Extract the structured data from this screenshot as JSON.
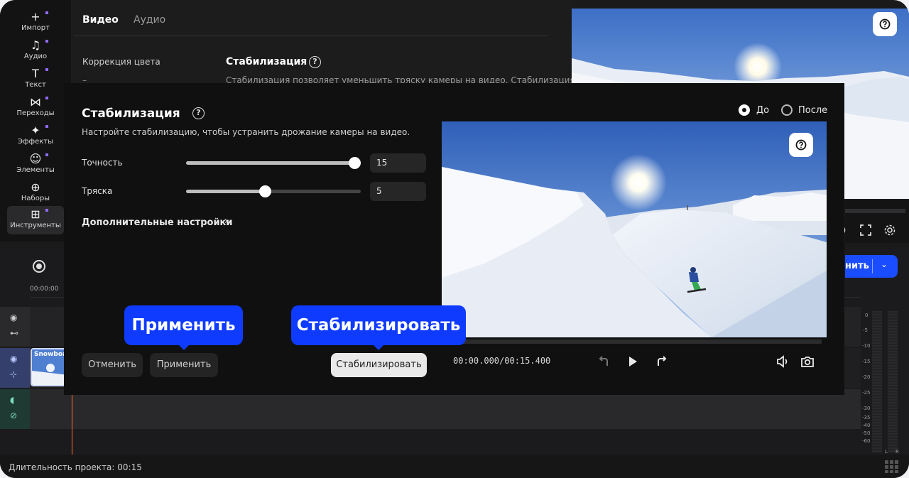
{
  "sidebar": {
    "items": [
      {
        "icon": "plus-icon",
        "glyph": "+",
        "label": "Импорт"
      },
      {
        "icon": "music-icon",
        "glyph": "♫",
        "label": "Аудио"
      },
      {
        "icon": "text-icon",
        "glyph": "T",
        "label": "Текст"
      },
      {
        "icon": "transitions-icon",
        "glyph": "⋈",
        "label": "Переходы"
      },
      {
        "icon": "sparkles-icon",
        "glyph": "✦",
        "label": "Эффекты"
      },
      {
        "icon": "smiley-icon",
        "glyph": "☺",
        "label": "Элементы"
      },
      {
        "icon": "bag-icon",
        "glyph": "⊕",
        "label": "Наборы"
      },
      {
        "icon": "tools-grid-icon",
        "glyph": "⊞",
        "label": "Инструменты"
      }
    ]
  },
  "editor": {
    "tab_video": "Видео",
    "tab_audio": "Аудио",
    "left_item": "Коррекция цвета",
    "left_dash": "–",
    "section_title": "Стабилизация",
    "section_desc": "Стабилизация позволяет уменьшить тряску камеры на видео. Стабилизация"
  },
  "modal": {
    "title": "Стабилизация",
    "description": "Настройте стабилизацию, чтобы устранить дрожание камеры на видео.",
    "accuracy_label": "Точность",
    "accuracy_value": "15",
    "accuracy_level": 1.0,
    "shake_label": "Тряска",
    "shake_value": "5",
    "shake_level": 0.45,
    "advanced_label": "Дополнительные настройки",
    "cancel_label": "Отменить",
    "apply_label": "Применить",
    "stabilize_label": "Стабилизировать",
    "radio_before": "До",
    "radio_after": "После",
    "timecode": "00:00.000/00:15.400"
  },
  "callouts": {
    "apply": "Применить",
    "stabilize": "Стабилизировать"
  },
  "timeline": {
    "time_marker": "00:00:00",
    "clip_label": "Snowboa",
    "export_label": "нить",
    "meter_labels": [
      "0",
      "-5",
      "-10",
      "-15",
      "-20",
      "-25",
      "-30",
      "-35",
      "-40",
      "-50",
      "-60"
    ],
    "meter_channels": [
      "L",
      "R"
    ]
  },
  "status": {
    "duration_text": "Длительность проекта: 00:15"
  },
  "colors": {
    "accent": "#0f3bff",
    "playhead": "#ff6a2b",
    "modal_bg": "#101011"
  }
}
